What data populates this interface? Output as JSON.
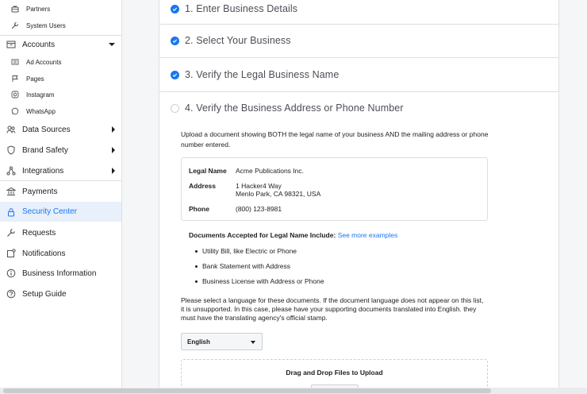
{
  "sidebar": {
    "items": [
      {
        "label": "Partners",
        "icon": "briefcase-icon"
      },
      {
        "label": "System Users",
        "icon": "wrench-icon"
      },
      {
        "label": "Accounts",
        "icon": "folder-icon"
      },
      {
        "label": "Ad Accounts",
        "icon": "ad-accounts-icon"
      },
      {
        "label": "Pages",
        "icon": "flag-icon"
      },
      {
        "label": "Instagram",
        "icon": "instagram-icon"
      },
      {
        "label": "WhatsApp",
        "icon": "whatsapp-icon"
      },
      {
        "label": "Data Sources",
        "icon": "data-sources-icon"
      },
      {
        "label": "Brand Safety",
        "icon": "shield-icon"
      },
      {
        "label": "Integrations",
        "icon": "integrations-icon"
      },
      {
        "label": "Payments",
        "icon": "bank-icon"
      },
      {
        "label": "Security Center",
        "icon": "lock-icon"
      },
      {
        "label": "Requests",
        "icon": "wrench-icon"
      },
      {
        "label": "Notifications",
        "icon": "notification-icon"
      },
      {
        "label": "Business Information",
        "icon": "info-icon"
      },
      {
        "label": "Setup Guide",
        "icon": "question-icon"
      }
    ]
  },
  "steps": [
    {
      "label": "1. Enter Business Details",
      "status": "complete"
    },
    {
      "label": "2. Select Your Business",
      "status": "complete"
    },
    {
      "label": "3. Verify the Legal Business Name",
      "status": "complete"
    },
    {
      "label": "4. Verify the Business Address or Phone Number",
      "status": "pending"
    }
  ],
  "upload": {
    "description": "Upload a document showing BOTH the legal name of your business AND the mailing address or phone number entered.",
    "info": {
      "legal_name_label": "Legal Name",
      "legal_name": "Acme Publications Inc.",
      "address_label": "Address",
      "address_line1": "1 Hacker4 Way",
      "address_line2": "Menlo Park, CA 98321, USA",
      "phone_label": "Phone",
      "phone": "(800) 123-8981"
    },
    "docs_heading": "Documents Accepted for Legal Name Include:",
    "docs_link": "See more examples",
    "docs": [
      "Utility Bill, like Electric or Phone",
      "Bank Statement with Address",
      "Business License with Address or Phone"
    ],
    "language_note": "Please select a language for these documents. If the document language does not appear on this list, it is unsupported. In this case, please have your supporting documents translated into English. they must have the translating agency's official stamp.",
    "language_selected": "English",
    "dropzone_label": "Drag and Drop Files to Upload"
  },
  "colors": {
    "accent": "#1877f2",
    "active_bg": "#e7f0fb",
    "border": "#dddfe2"
  }
}
